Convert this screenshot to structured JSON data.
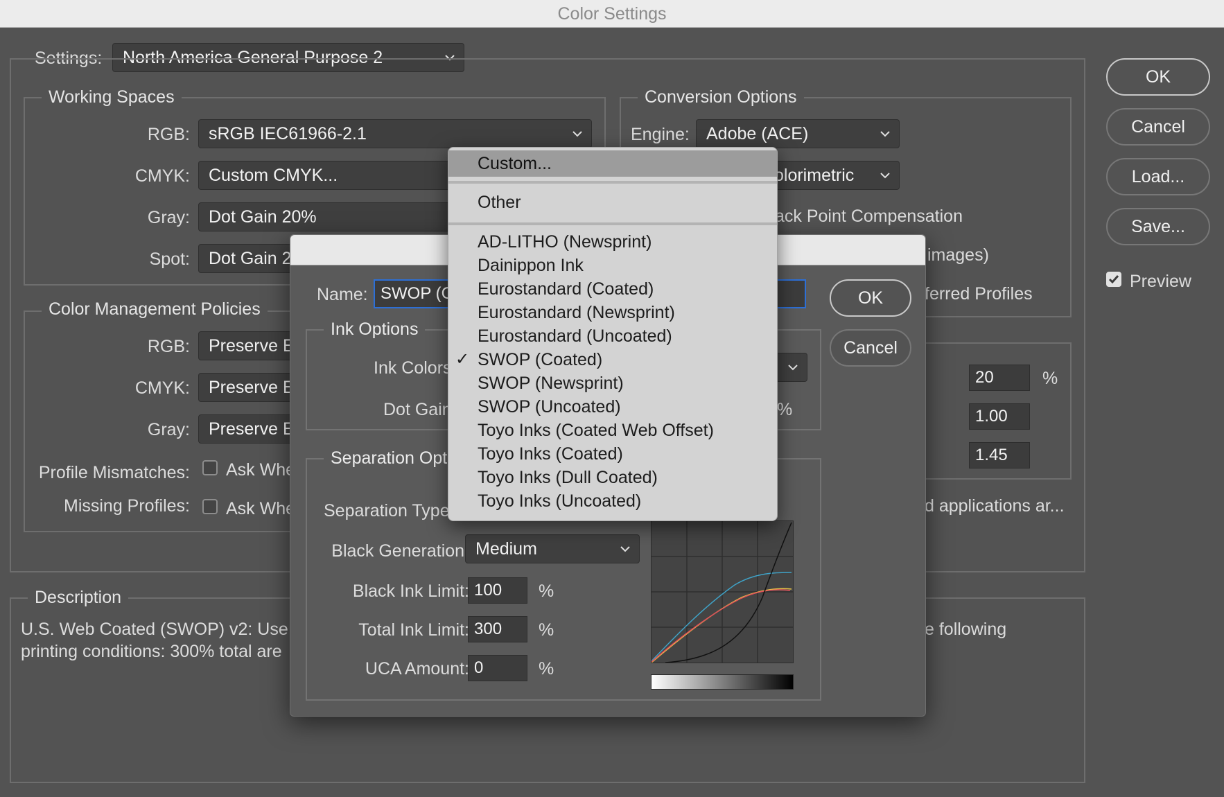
{
  "window": {
    "title": "Color Settings"
  },
  "settings": {
    "label": "Settings:",
    "value": "North America General Purpose 2"
  },
  "working_spaces": {
    "legend": "Working Spaces",
    "rgb_label": "RGB:",
    "rgb_value": "sRGB IEC61966-2.1",
    "cmyk_label": "CMYK:",
    "cmyk_value": "Custom CMYK...",
    "gray_label": "Gray:",
    "gray_value": "Dot Gain 20%",
    "spot_label": "Spot:",
    "spot_value": "Dot Gain 2"
  },
  "conversion": {
    "legend": "Conversion Options",
    "engine_label": "Engine:",
    "engine_value": "Adobe (ACE)",
    "intent_value": "olorimetric",
    "bpc_label": "ack Point Compensation",
    "dither_label": "images)",
    "scene_label": "ferred Profiles"
  },
  "advanced": {
    "field1": "20",
    "field1_unit": "%",
    "field2": "1.00",
    "field3": "1.45",
    "desc_fragment": "d applications ar..."
  },
  "policies": {
    "legend": "Color Management Policies",
    "rgb_label": "RGB:",
    "rgb_value": "Preserve E",
    "cmyk_label": "CMYK:",
    "cmyk_value": "Preserve E",
    "gray_label": "Gray:",
    "gray_value": "Preserve E",
    "mismatch_label": "Profile Mismatches:",
    "mismatch_check": "Ask Whe",
    "missing_label": "Missing Profiles:",
    "missing_check": "Ask Whe"
  },
  "description": {
    "legend": "Description",
    "line1": "U.S. Web Coated (SWOP) v2:  Use",
    "line2": "printing conditions: 300% total are",
    "line1_right": "e following"
  },
  "side_buttons": {
    "ok": "OK",
    "cancel": "Cancel",
    "load": "Load...",
    "save": "Save...",
    "preview": "Preview"
  },
  "dialog": {
    "name_label": "Name:",
    "name_value": "SWOP (C",
    "ok": "OK",
    "cancel": "Cancel",
    "ink_options": {
      "legend": "Ink Options",
      "ink_colors_label": "Ink Colors",
      "dot_gain_label": "Dot Gain",
      "pct": "%"
    },
    "separation": {
      "legend": "Separation Opt",
      "type_label": "Separation Type",
      "black_gen_label": "Black Generation:",
      "black_gen_value": "Medium",
      "black_ink_label": "Black Ink Limit:",
      "black_ink_value": "100",
      "total_ink_label": "Total Ink Limit:",
      "total_ink_value": "300",
      "uca_label": "UCA Amount:",
      "uca_value": "0",
      "pct": "%"
    }
  },
  "ink_menu": {
    "items": [
      "Custom...",
      "Other",
      "AD-LITHO (Newsprint)",
      "Dainippon Ink",
      "Eurostandard (Coated)",
      "Eurostandard (Newsprint)",
      "Eurostandard (Uncoated)",
      "SWOP (Coated)",
      "SWOP (Newsprint)",
      "SWOP (Uncoated)",
      "Toyo Inks (Coated Web Offset)",
      "Toyo Inks (Coated)",
      "Toyo Inks (Dull Coated)",
      "Toyo Inks (Uncoated)"
    ],
    "checkmark": "✓",
    "selected": "SWOP (Coated)",
    "highlighted": "Custom..."
  },
  "colors": {
    "window_bg": "#535353",
    "menu_bg": "#d3d3d3",
    "menu_highlight": "#9c9c9c",
    "curve_cyan": "#3fa3c8",
    "curve_red": "#e0505a",
    "curve_yellow": "#e8c447",
    "curve_black": "#111111"
  }
}
